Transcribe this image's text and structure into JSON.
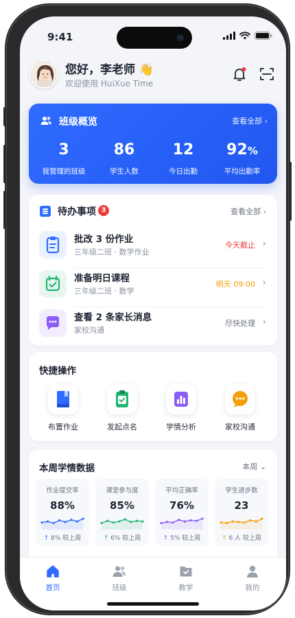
{
  "status_bar": {
    "time": "9:41"
  },
  "header": {
    "greeting": "您好，李老师 👋",
    "welcome": "欢迎使用 HuiXue Time"
  },
  "overview": {
    "title": "班级概览",
    "link": "查看全部",
    "stats": [
      {
        "value": "3",
        "unit": "",
        "label": "我管理的班级"
      },
      {
        "value": "86",
        "unit": "",
        "label": "学生人数"
      },
      {
        "value": "12",
        "unit": "",
        "label": "今日出勤"
      },
      {
        "value": "92",
        "unit": "%",
        "label": "平均出勤率"
      }
    ]
  },
  "todo": {
    "title": "待办事项",
    "badge": "3",
    "link": "查看全部",
    "items": [
      {
        "title": "批改 3 份作业",
        "sub": "三年级二班 · 数学作业",
        "status": "今天截止",
        "status_color": "#ef3b3b",
        "icon": "clipboard-icon"
      },
      {
        "title": "准备明日课程",
        "sub": "三年级二班 · 数学",
        "status": "明天 09:00",
        "status_color": "#f59e0b",
        "icon": "calendar-check-icon"
      },
      {
        "title": "查看 2 条家长消息",
        "sub": "家校沟通",
        "status": "尽快处理",
        "status_color": "#6b7280",
        "icon": "chat-bubble-icon"
      }
    ]
  },
  "quick_actions": {
    "title": "快捷操作",
    "items": [
      {
        "label": "布置作业",
        "icon": "book-icon",
        "color": "#2f6bff"
      },
      {
        "label": "发起点名",
        "icon": "checklist-icon",
        "color": "#22b573"
      },
      {
        "label": "学情分析",
        "icon": "bar-chart-icon",
        "color": "#8b5cf6"
      },
      {
        "label": "家校沟通",
        "icon": "message-icon",
        "color": "#f59e0b"
      }
    ]
  },
  "weekly": {
    "title": "本周学情数据",
    "period": "本周",
    "stats": [
      {
        "label": "作业提交率",
        "value": "88%",
        "change": "↑ 8%  较上周",
        "color": "#2f6bff",
        "trend": [
          0.45,
          0.55,
          0.4,
          0.65,
          0.5,
          0.7,
          0.55,
          0.8
        ]
      },
      {
        "label": "课堂参与度",
        "value": "85%",
        "change": "↑ 6%  较上周",
        "color": "#22b573",
        "trend": [
          0.4,
          0.6,
          0.45,
          0.55,
          0.75,
          0.5,
          0.6,
          0.55
        ]
      },
      {
        "label": "平均正确率",
        "value": "76%",
        "change": "↑ 5%  较上周",
        "color": "#8b5cf6",
        "trend": [
          0.4,
          0.5,
          0.45,
          0.7,
          0.55,
          0.65,
          0.6,
          0.8
        ]
      },
      {
        "label": "学生进步数",
        "value": "23",
        "change": "↑ 6 人  较上周",
        "color": "#f59e0b",
        "trend": [
          0.45,
          0.4,
          0.55,
          0.5,
          0.45,
          0.65,
          0.55,
          0.8
        ]
      }
    ]
  },
  "tabbar": {
    "items": [
      {
        "label": "首页",
        "icon": "home-icon",
        "active": true
      },
      {
        "label": "班级",
        "icon": "users-icon",
        "active": false
      },
      {
        "label": "教学",
        "icon": "folder-icon",
        "active": false
      },
      {
        "label": "我的",
        "icon": "profile-icon",
        "active": false
      }
    ]
  },
  "colors": {
    "primary": "#2f6bff",
    "danger": "#ef3b3b",
    "warning": "#f59e0b",
    "success": "#22b573",
    "purple": "#8b5cf6"
  }
}
